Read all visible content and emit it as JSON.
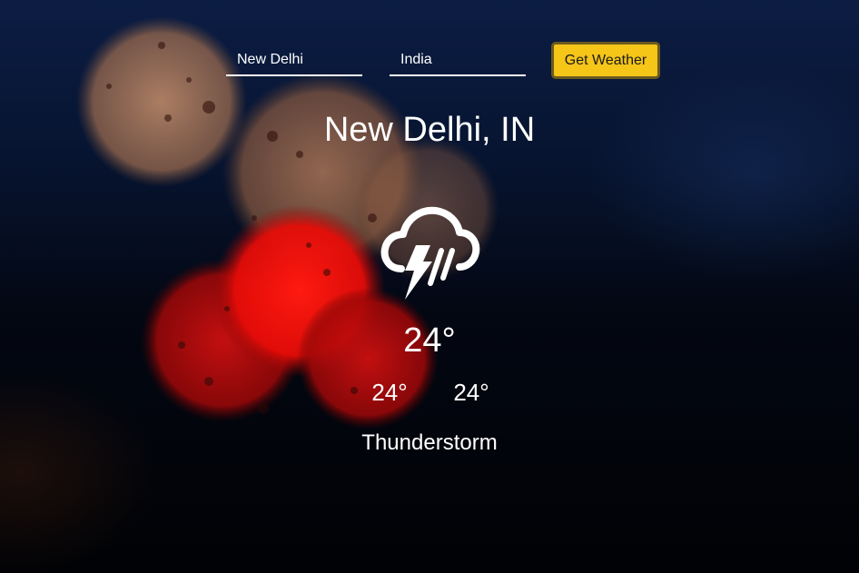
{
  "search": {
    "city_value": "New Delhi",
    "country_value": "India",
    "button_label": "Get Weather"
  },
  "weather": {
    "location": "New Delhi, IN",
    "icon": "thunderstorm-icon",
    "current_temp": "24°",
    "min_temp": "24°",
    "max_temp": "24°",
    "description": "Thunderstorm"
  },
  "colors": {
    "button_background": "#f5c518",
    "text": "#ffffff",
    "background": "#030712"
  }
}
